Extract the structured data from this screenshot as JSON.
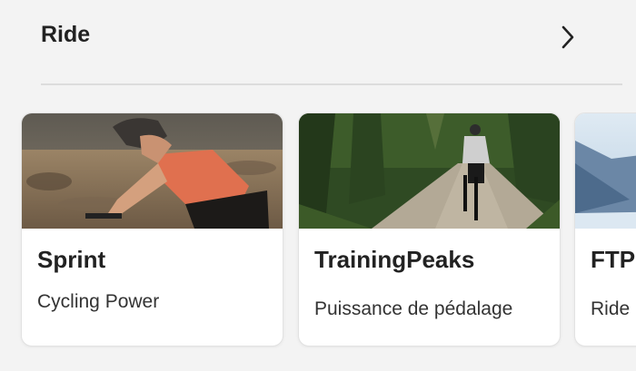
{
  "section": {
    "title": "Ride"
  },
  "cards": [
    {
      "title": "Sprint",
      "subtitle": "Cycling Power"
    },
    {
      "title": "TrainingPeaks",
      "subtitle": "Puissance de pédalage"
    },
    {
      "title": "FTP",
      "subtitle": "Ride"
    }
  ]
}
